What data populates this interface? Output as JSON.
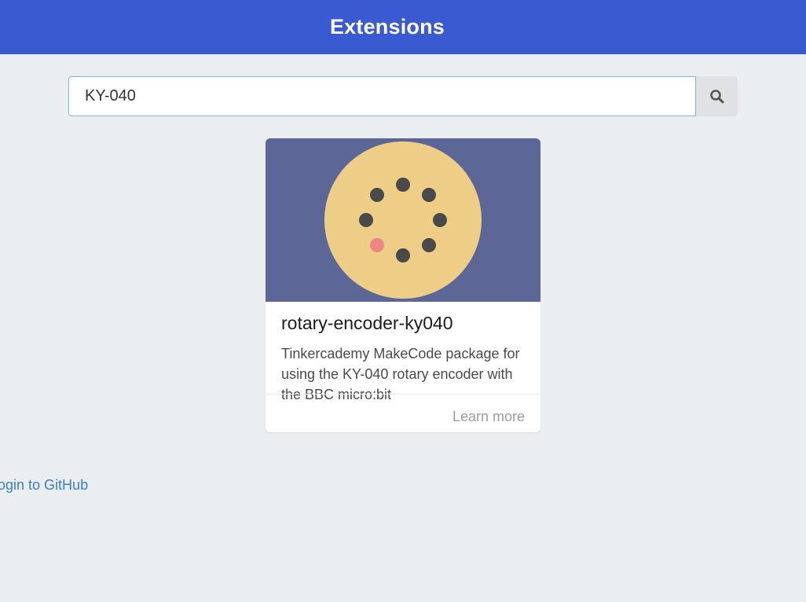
{
  "header": {
    "title": "Extensions"
  },
  "search": {
    "value": "KY-040",
    "button_icon": "search-icon"
  },
  "results": [
    {
      "title": "rotary-encoder-ky040",
      "description": "Tinkercademy MakeCode package for using the KY-040 rotary encoder with the BBC micro:bit",
      "link_label": "Learn more",
      "image_icon": "rotary-encoder-icon"
    }
  ],
  "footer": {
    "github_login_label": "Login to GitHub"
  },
  "colors": {
    "header_bg": "#3a5ad1",
    "page_bg": "#eaeef0",
    "card_image_bg": "#5d6797",
    "encoder_disc": "#eecd87",
    "encoder_dot": "#4a4a4a",
    "encoder_dot_active": "#ef8686",
    "link": "#3a7fc8"
  }
}
